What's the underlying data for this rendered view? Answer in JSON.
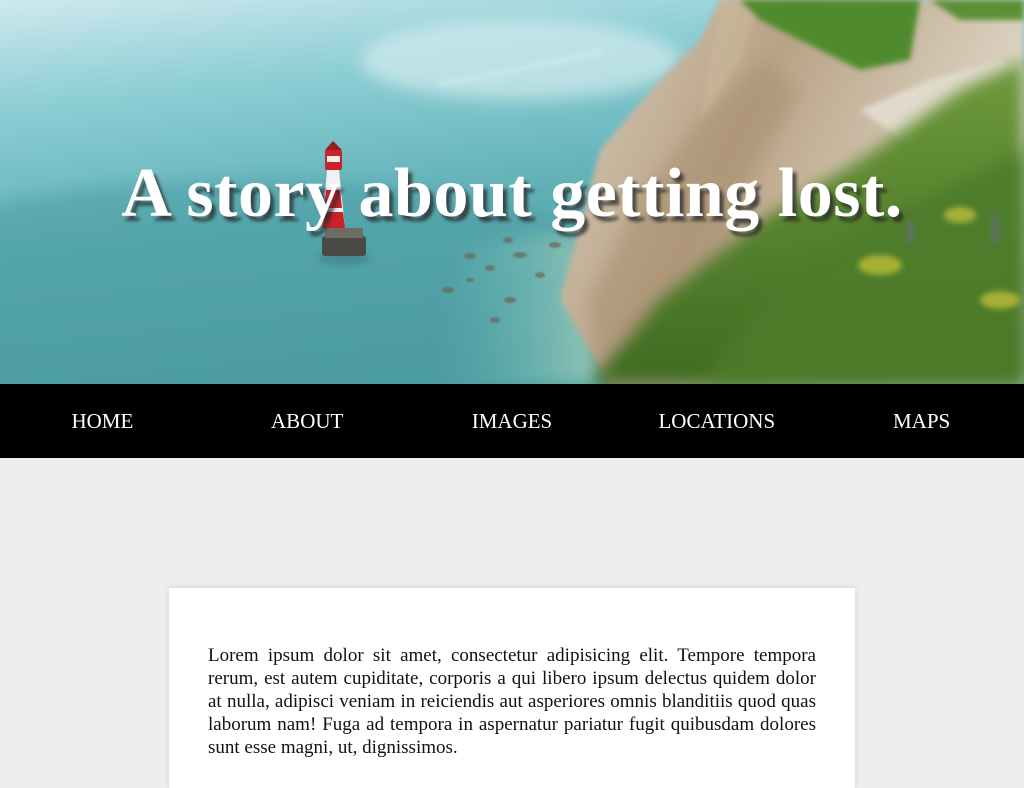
{
  "hero": {
    "title": "A story about getting lost.",
    "image": "lighthouse-cliffs-photo"
  },
  "nav": {
    "items": [
      {
        "label": "HOME"
      },
      {
        "label": "ABOUT"
      },
      {
        "label": "IMAGES"
      },
      {
        "label": "LOCATIONS"
      },
      {
        "label": "MAPS"
      }
    ]
  },
  "content": {
    "paragraph": "Lorem ipsum dolor sit amet, consectetur adipisicing elit. Tempore tempora rerum, est autem cupiditate, corporis a qui libero ipsum delectus quidem dolor at nulla, adipisci veniam in reiciendis aut asperiores omnis blanditiis quod quas laborum nam! Fuga ad tempora in aspernatur pariatur fugit quibusdam dolores sunt esse magni, ut, dignissimos."
  },
  "colors": {
    "nav_background": "#000000",
    "nav_text": "#ffffff",
    "page_background": "#eeeeee",
    "card_background": "#ffffff"
  }
}
